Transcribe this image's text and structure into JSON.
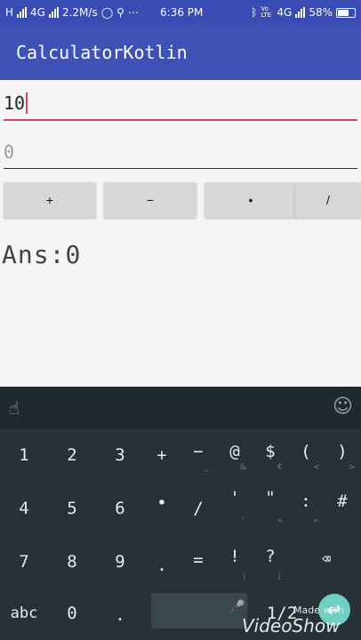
{
  "status_bar": {
    "network_label": "H",
    "network_type": "4G",
    "speed": "2.2M/s",
    "time": "6:36 PM",
    "volte": "Vo LTE",
    "network_type_2": "4G",
    "battery_percent": "58%"
  },
  "app_bar": {
    "title": "CalculatorKotlin"
  },
  "inputs": {
    "first_value": "10",
    "second_placeholder": "0"
  },
  "operators": [
    "+",
    "−",
    "•",
    "/"
  ],
  "answer": {
    "label": "Ans",
    "separator": ":",
    "value": "0"
  },
  "keyboard": {
    "rows": [
      [
        {
          "label": "1"
        },
        {
          "label": "2"
        },
        {
          "label": "3"
        },
        {
          "label": "+"
        },
        {
          "label": "−",
          "sub": "_"
        },
        {
          "label": "@",
          "sub": "&"
        },
        {
          "label": "$",
          "sub": "€"
        },
        {
          "label": "(",
          "sub": "<"
        },
        {
          "label": ")",
          "sub": ">"
        }
      ],
      [
        {
          "label": "4"
        },
        {
          "label": "5"
        },
        {
          "label": "6"
        },
        {
          "label": "•"
        },
        {
          "label": "/"
        },
        {
          "label": "'",
          "sub": "‘"
        },
        {
          "label": "\"",
          "sub": "«"
        },
        {
          "label": ":",
          "sub": "»"
        },
        {
          "label": "#"
        }
      ],
      [
        {
          "label": "7"
        },
        {
          "label": "8"
        },
        {
          "label": "9"
        },
        {
          "label": "."
        },
        {
          "label": "="
        },
        {
          "label": "!",
          "sub": "¡"
        },
        {
          "label": "?",
          "sub": "¿"
        }
      ]
    ],
    "bottom_row": {
      "abc": "abc",
      "zero": "0",
      "dot": ".",
      "fraction": "1/2"
    }
  },
  "watermark": {
    "made_with": "Made with",
    "brand": "VideoShow"
  }
}
